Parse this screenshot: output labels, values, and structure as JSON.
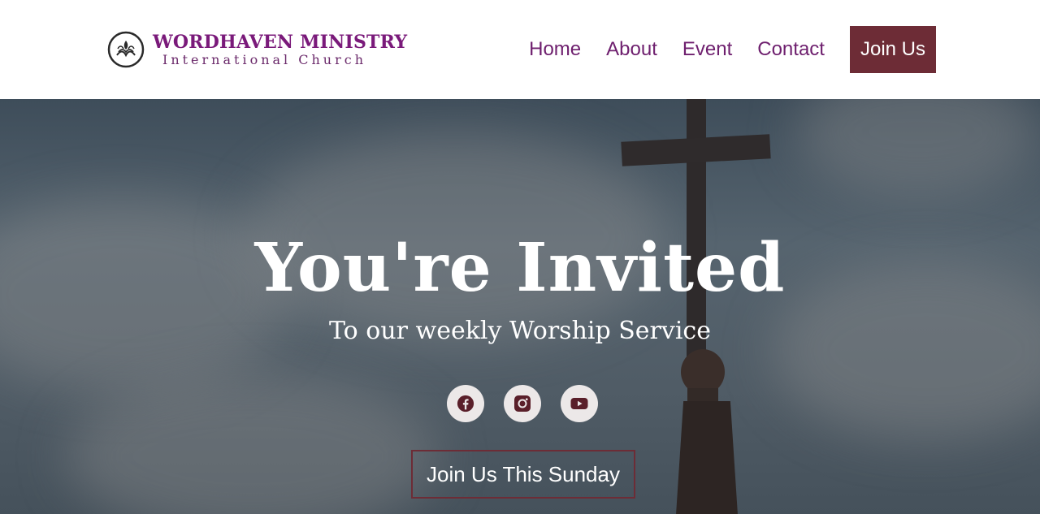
{
  "brand": {
    "name": "WORDHAVEN MINISTRY",
    "subtitle": "International Church",
    "color": "#7a1a7a"
  },
  "nav": {
    "items": [
      {
        "label": "Home"
      },
      {
        "label": "About"
      },
      {
        "label": "Event"
      },
      {
        "label": "Contact"
      }
    ],
    "join_label": "Join Us",
    "join_color": "#6d2c36"
  },
  "hero": {
    "title": "You're Invited",
    "subtitle": "To our weekly Worship Service",
    "socials": [
      {
        "name": "facebook-icon"
      },
      {
        "name": "instagram-icon"
      },
      {
        "name": "youtube-icon"
      }
    ],
    "cta_label": "Join Us This Sunday"
  },
  "colors": {
    "accent": "#6d2c36",
    "nav_text": "#6e1f6e"
  }
}
